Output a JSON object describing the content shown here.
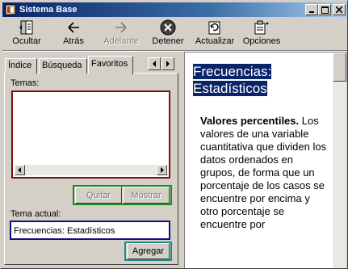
{
  "window": {
    "title": "Sistema Base"
  },
  "toolbar": {
    "items": [
      {
        "label": "Ocultar",
        "icon": "hide-pane-icon",
        "enabled": true
      },
      {
        "label": "Atrás",
        "icon": "back-arrow-icon",
        "enabled": true
      },
      {
        "label": "Adelante",
        "icon": "forward-arrow-icon",
        "enabled": false
      },
      {
        "label": "Detener",
        "icon": "stop-icon",
        "enabled": true
      },
      {
        "label": "Actualizar",
        "icon": "refresh-icon",
        "enabled": true
      },
      {
        "label": "Opciones",
        "icon": "options-icon",
        "enabled": true
      }
    ]
  },
  "tabs": [
    {
      "label": "Índice",
      "active": false
    },
    {
      "label": "Búsqueda",
      "active": false
    },
    {
      "label": "Favoritos",
      "active": true
    }
  ],
  "favorites": {
    "temas_label": "Temas:",
    "topics": [],
    "remove_label": "Quitar",
    "show_label": "Mostrar",
    "current_label": "Tema actual:",
    "current_value": "Frecuencias: Estadísticos",
    "add_label": "Agregar"
  },
  "content": {
    "heading": "Frecuencias: Estadísticos",
    "term": "Valores percentiles.",
    "body": " Los valores de una variable cuantitativa que dividen los datos ordenados en grupos, de forma que un porcentaje de los casos se encuentre por encima y otro porcentaje se encuentre por"
  },
  "colors": {
    "titlebar_start": "#0a246a",
    "highlight": "#0a246a",
    "listbox_border": "#7b1010",
    "button_group_border": "#1a8a1a",
    "current_topic_border": "#10107b",
    "add_button_border": "#1a8a8a"
  }
}
